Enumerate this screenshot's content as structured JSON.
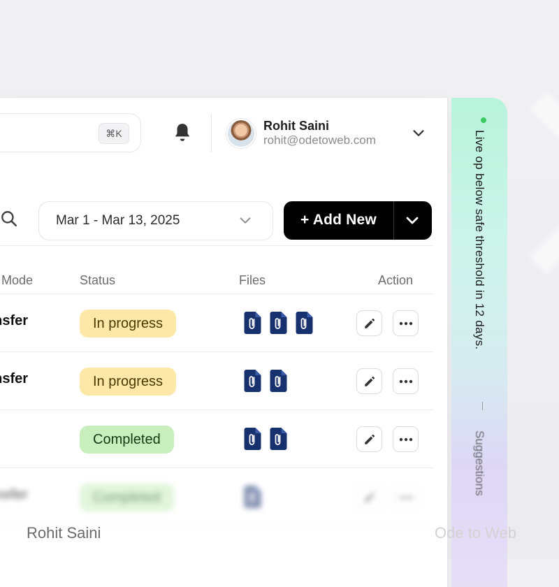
{
  "header": {
    "search_shortcut": "⌘K",
    "user_name": "Rohit Saini",
    "user_email": "rohit@odetoweb.com"
  },
  "toolbar": {
    "date_range": "Mar 1 - Mar 13, 2025",
    "add_label": "+ Add New"
  },
  "table": {
    "headers": {
      "mode": "Mode",
      "status": "Status",
      "files": "Files",
      "action": "Action"
    },
    "rows": [
      {
        "mode": "ansfer",
        "status": "In progress",
        "status_type": "progress",
        "files": 3
      },
      {
        "mode": "ansfer",
        "status": "In progress",
        "status_type": "progress",
        "files": 2
      },
      {
        "mode": "",
        "status": "Completed",
        "status_type": "done",
        "files": 2
      },
      {
        "mode": "ansfer",
        "status": "Completed",
        "status_type": "done",
        "files": 1
      }
    ]
  },
  "side_panel": {
    "alert_text": "Live op below safe threshold in 12 days.",
    "suggestion_text": "Suggestions"
  },
  "footer": {
    "left": "Rohit Saini",
    "right": "Ode to Web"
  },
  "colors": {
    "progress_bg": "#fde8a8",
    "done_bg": "#c8eebe",
    "file_icon": "#17306e",
    "live_dot": "#3bc964",
    "primary_button": "#000000"
  }
}
